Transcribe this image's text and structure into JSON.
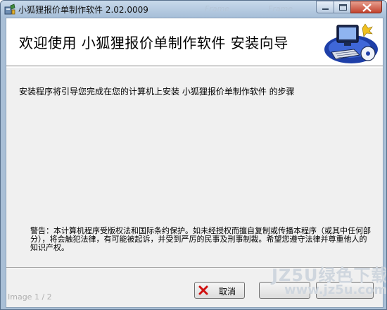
{
  "window": {
    "title": "小狐狸报价单制作软件 2.02.0009",
    "ghost_labels": [
      "Frame",
      "Frame"
    ]
  },
  "header": {
    "title": "欢迎使用  小狐狸报价单制作软件  安装向导",
    "art_icon": "computer-setup-icon"
  },
  "body": {
    "intro": "安装程序将引导您完成在您的计算机上安装  小狐狸报价单制作软件  的步骤",
    "warning": "警告：本计算机程序受版权法和国际条约保护。如未经授权而擅自复制或传播本程序（或其中任何部分），将会触犯法律，有可能被起诉，并受到严厉的民事及刑事制裁。希望您遵守法律并尊重他人的知识产权。"
  },
  "buttons": {
    "cancel": "取消",
    "cancel_icon": "red-x-icon"
  },
  "watermark": {
    "line1": "JZ5U绿色下载",
    "line2": "www.jz5u.com"
  },
  "viewer": {
    "counter": "Image 1 / 2"
  },
  "colors": {
    "titlebar": "#a6bed8",
    "close_button": "#c2432e",
    "client_bg": "#f0f0f0"
  }
}
